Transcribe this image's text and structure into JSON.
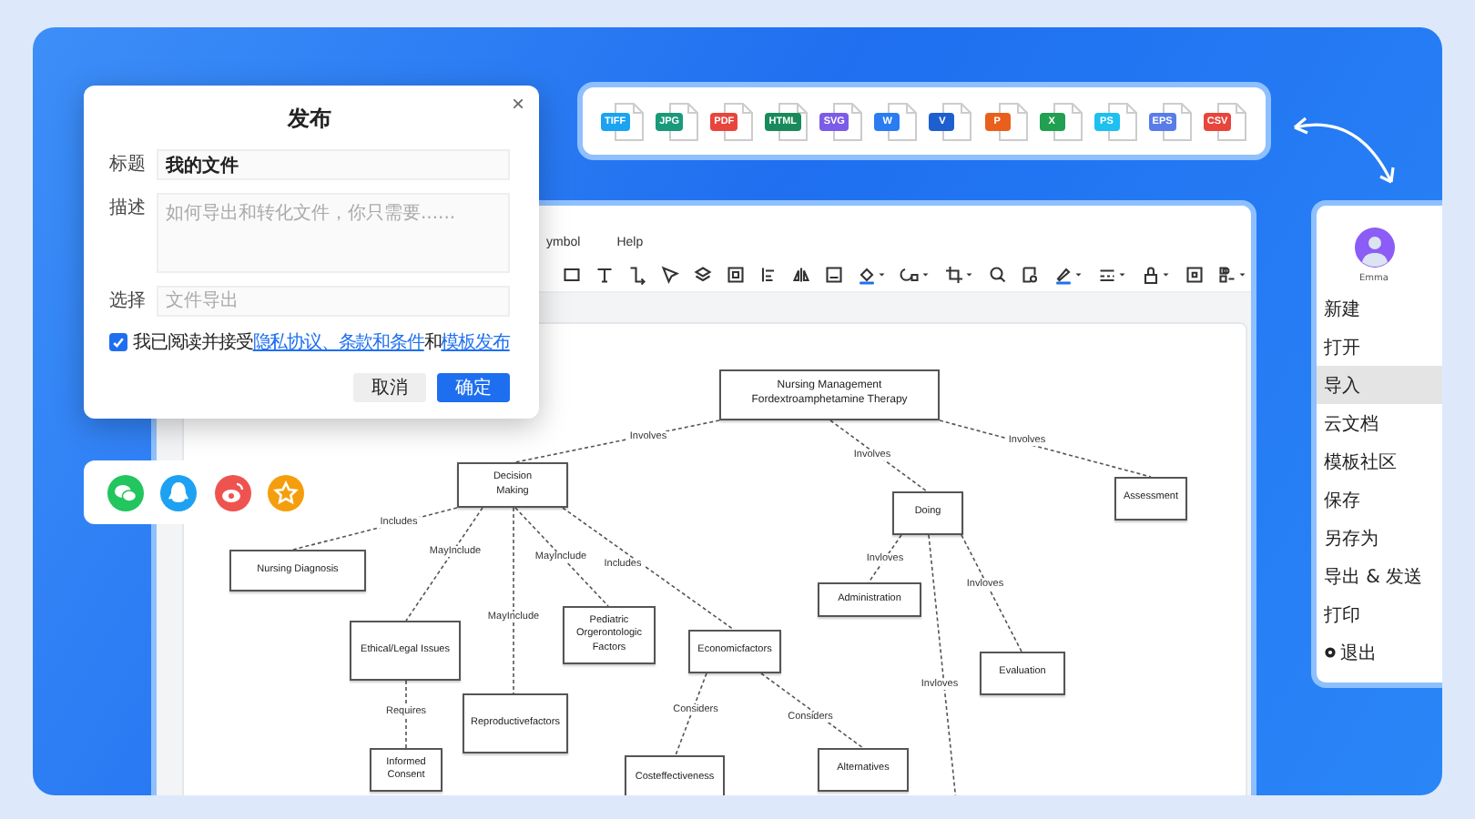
{
  "editor": {
    "menu": [
      "ymbol",
      "Help"
    ]
  },
  "diagram": {
    "nodes": [
      {
        "label": "Nursing Management\nFordextroamphetamine Therapy"
      },
      {
        "label": "Decision\nMaking"
      },
      {
        "label": "Nursing Diagnosis"
      },
      {
        "label": "Ethical/Legal Issues"
      },
      {
        "label": "Informed\nConsent"
      },
      {
        "label": "Reproductivefactors"
      },
      {
        "label": "Pediatric\nOrgerontologic\nFactors"
      },
      {
        "label": "Economicfactors"
      },
      {
        "label": "Costeffectiveness"
      },
      {
        "label": "Alternatives"
      },
      {
        "label": "Doing"
      },
      {
        "label": "Administration"
      },
      {
        "label": "Evaluation"
      },
      {
        "label": "Assessment"
      }
    ],
    "edges": [
      {
        "label": "Involves"
      },
      {
        "label": "Involves"
      },
      {
        "label": "Involves"
      },
      {
        "label": "Includes"
      },
      {
        "label": "MayInclude"
      },
      {
        "label": "MayInclude"
      },
      {
        "label": "MayInclude"
      },
      {
        "label": "Includes"
      },
      {
        "label": "Requires"
      },
      {
        "label": "Considers"
      },
      {
        "label": "Considers"
      },
      {
        "label": "Invloves"
      },
      {
        "label": "Invloves"
      },
      {
        "label": "Invloves"
      }
    ]
  },
  "dialog": {
    "title": "发布",
    "close": "×",
    "fields": [
      {
        "label": "标题",
        "kind": "input",
        "value": "我的文件"
      },
      {
        "label": "描述",
        "kind": "textarea",
        "placeholder": "如何导出和转化文件，你只需要......"
      },
      {
        "label": "选择",
        "kind": "input",
        "placeholder": "文件导出"
      }
    ],
    "consent": {
      "checked": true,
      "text": "我已阅读并接受",
      "link": "隐私协议、条款和条件",
      "joiner": "和",
      "link_2": "模板发布"
    },
    "buttons": [
      {
        "label": "取消",
        "kind": "secondary"
      },
      {
        "label": "确定",
        "kind": "primary"
      }
    ]
  },
  "formats": [
    {
      "label": "TIFF",
      "color": "#1aa3f0"
    },
    {
      "label": "JPG",
      "color": "#1a9a7a"
    },
    {
      "label": "PDF",
      "color": "#e8453c"
    },
    {
      "label": "HTML",
      "color": "#1a8a5a"
    },
    {
      "label": "SVG",
      "color": "#7b5ce6"
    },
    {
      "label": "W",
      "color": "#2b7cf0"
    },
    {
      "label": "V",
      "color": "#1e5fd0"
    },
    {
      "label": "P",
      "color": "#e8601c"
    },
    {
      "label": "X",
      "color": "#20a050"
    },
    {
      "label": "PS",
      "color": "#1ec0f0"
    },
    {
      "label": "EPS",
      "color": "#5a7ce8"
    },
    {
      "label": "CSV",
      "color": "#e8453c"
    }
  ],
  "account": {
    "name": "Emma",
    "items": [
      {
        "label": "新建",
        "kind": "plain",
        "selected": false
      },
      {
        "label": "打开",
        "kind": "plain",
        "selected": false
      },
      {
        "label": "导入",
        "kind": "plain",
        "selected": true
      },
      {
        "label": "云文档",
        "kind": "plain",
        "selected": false
      },
      {
        "label": "模板社区",
        "kind": "plain",
        "selected": false
      },
      {
        "label": "保存",
        "kind": "plain",
        "selected": false
      },
      {
        "label": "另存为",
        "kind": "plain",
        "selected": false
      },
      {
        "label": "导出 & 发送",
        "kind": "plain",
        "selected": false
      },
      {
        "label": "打印",
        "kind": "plain",
        "selected": false
      },
      {
        "label": "退出",
        "kind": "exit",
        "selected": false
      }
    ]
  }
}
